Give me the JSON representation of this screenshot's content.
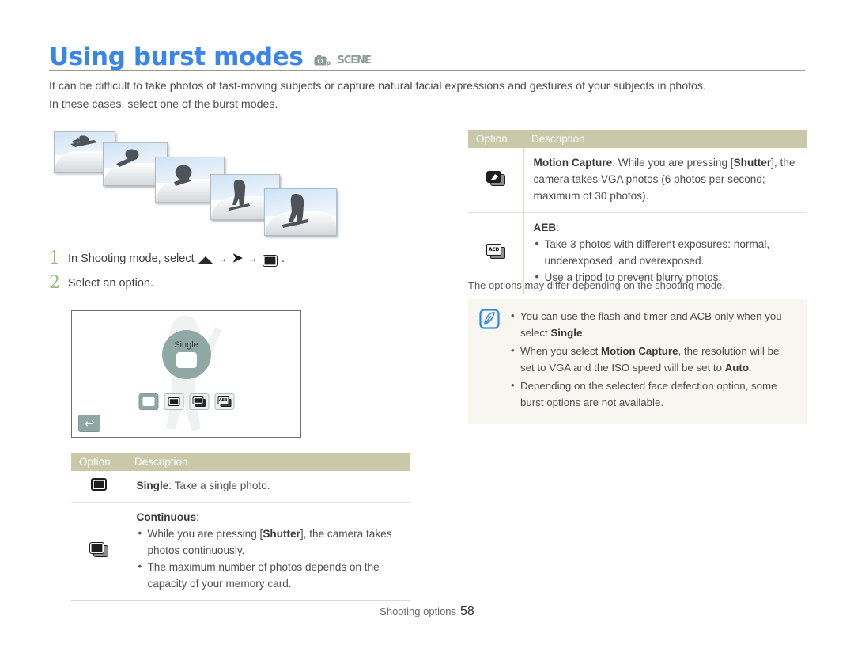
{
  "header": {
    "title": "Using burst modes",
    "mode_icons": [
      {
        "name": "camera-program-icon",
        "label": "p"
      },
      {
        "name": "scene-icon",
        "label": "SCENE"
      }
    ],
    "accent_color": "#3a86e8",
    "rule_color": "#9a9b8c"
  },
  "intro": {
    "line1": "It can be difficult to take photos of fast-moving subjects or capture natural facial expressions and gestures of your subjects in photos.",
    "line2": "In these cases, select one of the burst modes."
  },
  "illustration": {
    "caption": "",
    "frames": 5,
    "subject": "snowboarder"
  },
  "steps": [
    {
      "number": "1",
      "prefix": "In Shooting mode, select",
      "icons": [
        "up-arrow-icon",
        "chevron-right-icon",
        "burst-mode-icon"
      ],
      "suffix": "."
    },
    {
      "number": "2",
      "prefix": "Select an option.",
      "icons": [],
      "suffix": ""
    }
  ],
  "camera_screen": {
    "selected_label": "Single",
    "options": [
      "single",
      "continuous",
      "motion-capture",
      "aeb"
    ],
    "selected_index": 0,
    "back_label": "↩"
  },
  "left_table": {
    "headers": [
      "Option",
      "Description"
    ],
    "rows": [
      {
        "icon": "single-icon",
        "title": "Single",
        "title_sep": ": ",
        "text": "Take a single photo.",
        "bullets": []
      },
      {
        "icon": "continuous-icon",
        "title": "Continuous",
        "title_sep": ":",
        "text": "",
        "bullets": [
          "While you are pressing [Shutter], the camera takes photos continuously.",
          "The maximum number of photos depends on the capacity of your memory card."
        ]
      }
    ]
  },
  "right_table": {
    "headers": [
      "Option",
      "Description"
    ],
    "rows": [
      {
        "icon": "motion-capture-icon",
        "title": "Motion Capture",
        "title_sep": ": ",
        "text": "While you are pressing [Shutter], the camera takes VGA photos (6 photos per second; maximum of 30 photos).",
        "bullets": []
      },
      {
        "icon": "aeb-icon",
        "title": "AEB",
        "title_sep": ":",
        "text": "",
        "bullets": [
          "Take 3 photos with different exposures: normal, underexposed, and overexposed.",
          "Use a tripod to prevent blurry photos."
        ]
      }
    ],
    "footnote": "The options may differ depending on the shooting mode."
  },
  "note_box": {
    "icon": "note-pen-icon",
    "bullets": [
      "You can use the flash and timer and ACB only when you select Single.",
      "When you select Motion Capture, the resolution will be set to VGA and the ISO speed will be set to Auto.",
      "Depending on the selected face defection option, some burst options are not available."
    ]
  },
  "footer": {
    "section": "Shooting options",
    "page": "58"
  },
  "colors": {
    "table_header_bg": "#c9c9aa",
    "note_bg": "#f7f6f1",
    "step_number": "#9aba7e",
    "screen_accent": "#90a8a5"
  }
}
